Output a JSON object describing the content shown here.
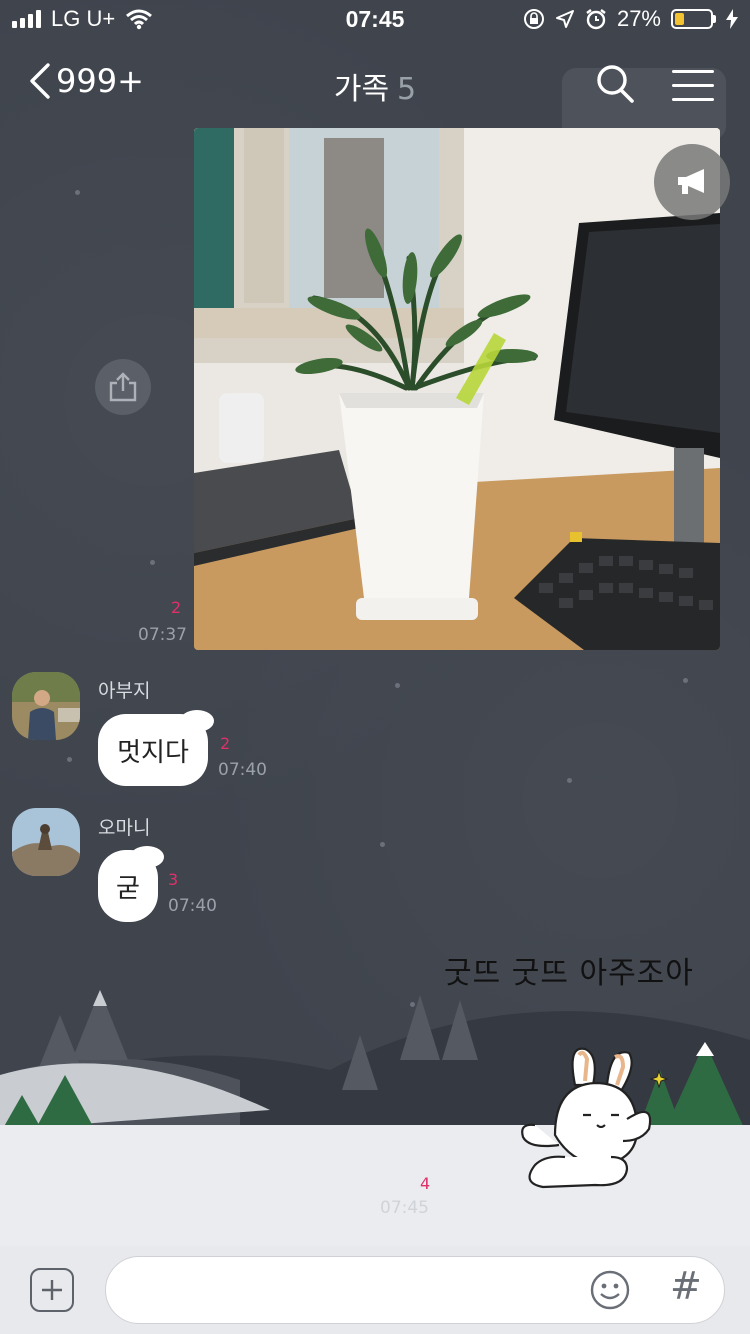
{
  "status_bar": {
    "carrier": "LG U+",
    "time": "07:45",
    "battery_percent": "27%",
    "battery_level": 0.27
  },
  "header": {
    "unread_badge": "999+",
    "title": "가족",
    "member_count": "5"
  },
  "messages": {
    "photo": {
      "unread": "2",
      "time": "07:37"
    },
    "father": {
      "sender": "아부지",
      "text": "멋지다",
      "unread": "2",
      "time": "07:40"
    },
    "mother": {
      "sender": "오마니",
      "text": "굳",
      "unread": "3",
      "time": "07:40"
    },
    "sticker": {
      "caption": "굿뜨 굿뜨 아주조아",
      "unread": "4",
      "time": "07:45"
    }
  },
  "input": {
    "placeholder": "",
    "hash_symbol": "#"
  },
  "colors": {
    "background": "#3f444d",
    "unread_accent": "#e0306a",
    "battery": "#f2c230"
  },
  "icons": [
    "signal-icon",
    "wifi-icon",
    "lock-rotation-icon",
    "location-icon",
    "alarm-icon",
    "battery-icon",
    "charging-icon",
    "back-chevron-icon",
    "search-icon",
    "menu-icon",
    "megaphone-icon",
    "share-icon",
    "plus-icon",
    "emoji-icon",
    "hash-icon"
  ]
}
